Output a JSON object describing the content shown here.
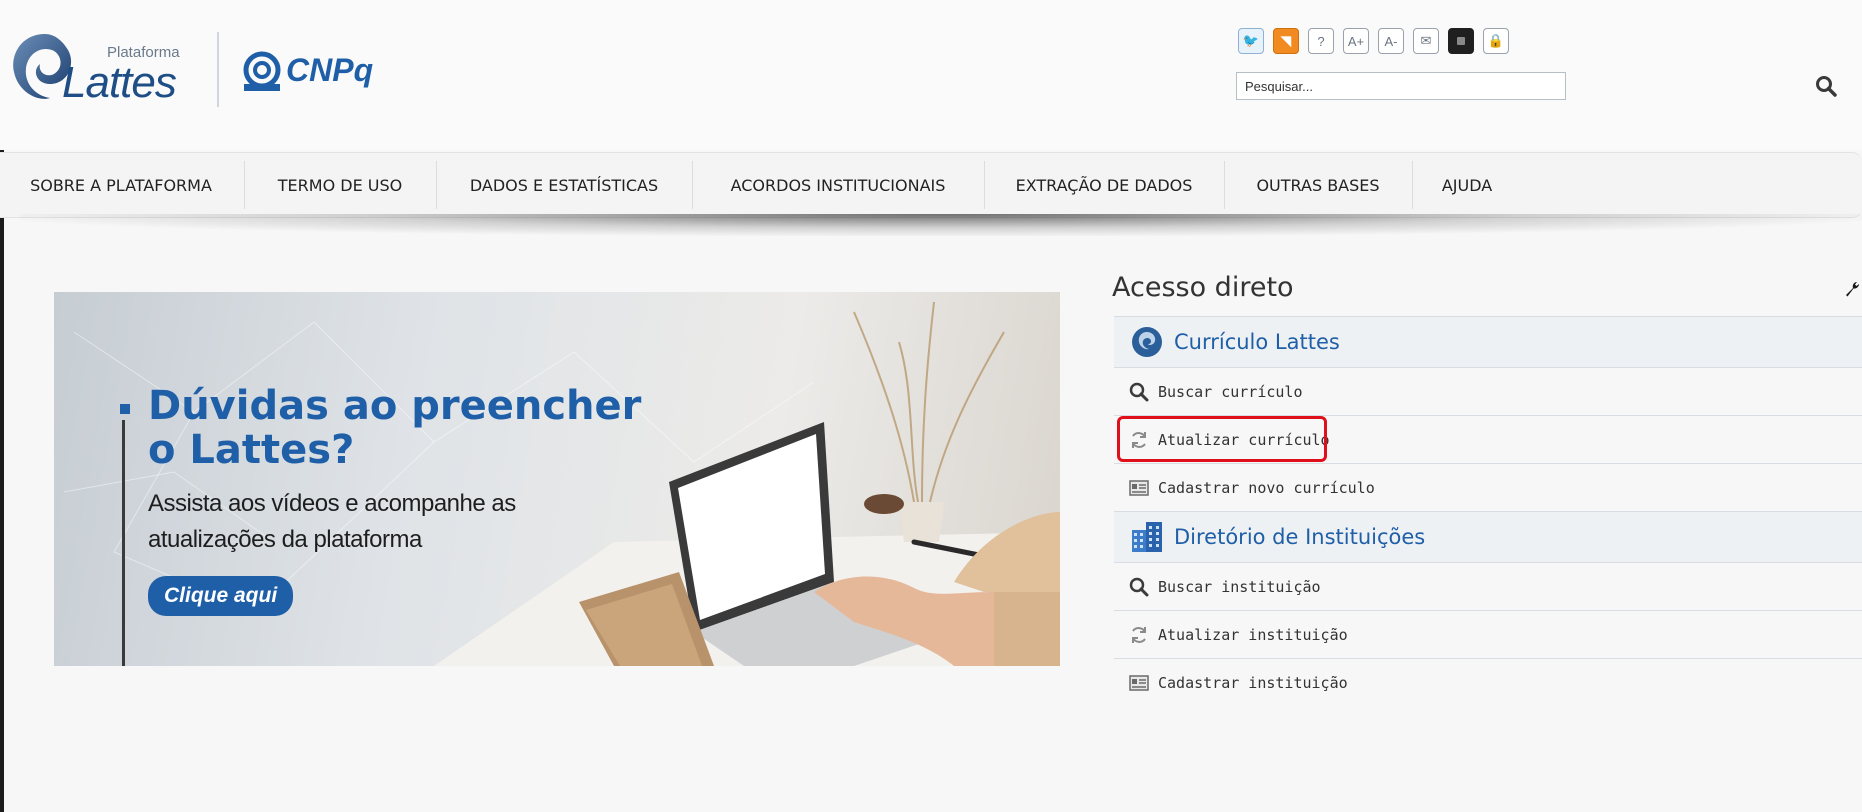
{
  "header": {
    "lattes_small": "Plataforma",
    "lattes_big": "Lattes",
    "cnpq_text": "CNPq",
    "search": {
      "placeholder": "Pesquisar..."
    },
    "util_buttons": [
      {
        "name": "twitter-icon",
        "glyph": "🐦"
      },
      {
        "name": "rss-icon",
        "glyph": "◥"
      },
      {
        "name": "help-icon",
        "glyph": "?"
      },
      {
        "name": "font-increase-icon",
        "glyph": "A+"
      },
      {
        "name": "font-decrease-icon",
        "glyph": "A-"
      },
      {
        "name": "email-icon",
        "glyph": "✉"
      },
      {
        "name": "contrast-icon",
        "glyph": ""
      },
      {
        "name": "lock-icon",
        "glyph": "🔒"
      }
    ]
  },
  "nav": {
    "items": [
      "SOBRE A PLATAFORMA",
      "TERMO DE USO",
      "DADOS E ESTATÍSTICAS",
      "ACORDOS INSTITUCIONAIS",
      "EXTRAÇÃO DE DADOS",
      "OUTRAS BASES",
      "AJUDA"
    ]
  },
  "banner": {
    "title_line1": "Dúvidas ao preencher",
    "title_line2": "o Lattes?",
    "subtitle_line1": "Assista aos vídeos e acompanhe as",
    "subtitle_line2": "atualizações da plataforma",
    "cta": "Clique aqui"
  },
  "sidebar": {
    "title": "Acesso direto",
    "sections": [
      {
        "heading": "Currículo Lattes",
        "icon": "lattes-logo-icon",
        "links": [
          {
            "label": "Buscar currículo",
            "icon": "search-icon"
          },
          {
            "label": "Atualizar currículo",
            "icon": "refresh-icon",
            "highlighted": true
          },
          {
            "label": "Cadastrar novo currículo",
            "icon": "form-icon"
          }
        ]
      },
      {
        "heading": "Diretório de Instituições",
        "icon": "building-icon",
        "links": [
          {
            "label": "Buscar instituição",
            "icon": "search-icon"
          },
          {
            "label": "Atualizar instituição",
            "icon": "refresh-icon"
          },
          {
            "label": "Cadastrar instituição",
            "icon": "form-icon"
          }
        ]
      }
    ]
  },
  "colors": {
    "brand_blue": "#1f5fa8",
    "highlight_red": "#e0101a",
    "rss_orange": "#f18a21"
  }
}
